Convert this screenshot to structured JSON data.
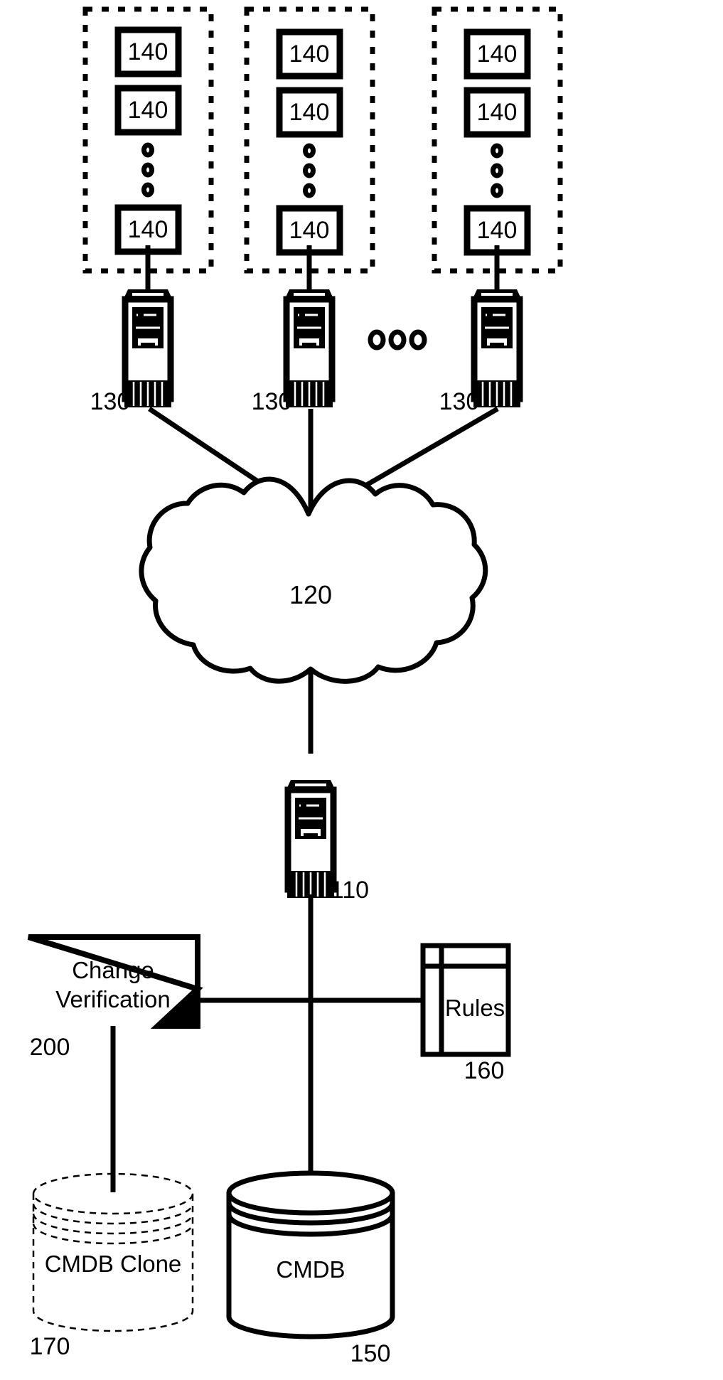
{
  "figure": {
    "type": "patent-network-diagram",
    "background_color": "#ffffff",
    "line_color": "#000000"
  },
  "endpoint_groups": [
    {
      "group_id": "group-1",
      "border_style": "dashed",
      "nodes": [
        {
          "label": "140"
        },
        {
          "label": "140"
        },
        {
          "label": "140"
        }
      ],
      "ellipsis": "vertical-three-dots",
      "server": {
        "label": "130",
        "icon": "server-tower-icon"
      }
    },
    {
      "group_id": "group-2",
      "border_style": "dashed",
      "nodes": [
        {
          "label": "140"
        },
        {
          "label": "140"
        },
        {
          "label": "140"
        }
      ],
      "ellipsis": "vertical-three-dots",
      "server": {
        "label": "130",
        "icon": "server-tower-icon"
      }
    },
    {
      "group_id": "group-3",
      "border_style": "dashed",
      "nodes": [
        {
          "label": "140"
        },
        {
          "label": "140"
        },
        {
          "label": "140"
        }
      ],
      "ellipsis": "vertical-three-dots",
      "server": {
        "label": "130",
        "icon": "server-tower-icon"
      }
    }
  ],
  "group_ellipsis": {
    "label": "horizontal-three-circles",
    "count": 3
  },
  "network": {
    "shape": "cloud",
    "label": "120"
  },
  "central_server": {
    "icon": "server-tower-icon",
    "label": "110"
  },
  "change_verification": {
    "title_line_1": "Change",
    "title_line_2": "Verification",
    "label": "200",
    "shape": "folded-corner-box"
  },
  "rules": {
    "title": "Rules",
    "label": "160",
    "shape": "book-icon"
  },
  "cmdb_clone": {
    "title": "CMDB Clone",
    "label": "170",
    "shape": "dashed-cylinder"
  },
  "cmdb": {
    "title": "CMDB",
    "label": "150",
    "shape": "solid-cylinder"
  }
}
